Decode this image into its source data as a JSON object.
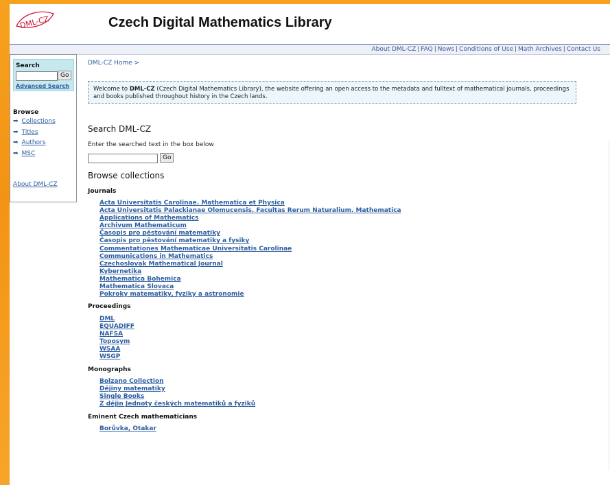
{
  "header": {
    "logo_text": "DML-CZ",
    "title": "Czech Digital Mathematics Library"
  },
  "topbar": {
    "links": [
      "About DML-CZ",
      "FAQ",
      "News",
      "Conditions of Use",
      "Math Archives",
      "Contact Us"
    ]
  },
  "sidebar": {
    "search_label": "Search",
    "search_value": "",
    "go_label": "Go",
    "advanced_search": "Advanced Search",
    "browse_title": "Browse",
    "browse_items": [
      "Collections",
      "Titles",
      "Authors",
      "MSC"
    ],
    "about": "About DML-CZ"
  },
  "main": {
    "breadcrumb": "DML-CZ Home >",
    "welcome_prefix": "Welcome to ",
    "welcome_bold": "DML-CZ",
    "welcome_rest": " (Czech Digital Mathematics Library), the website offering an open access to the metadata and fulltext of mathematical journals, proceedings and books published throughout history in the Czech lands.",
    "search_heading": "Search DML-CZ",
    "search_hint": "Enter the searched text in the box below",
    "search_value": "",
    "go_label": "Go",
    "browse_heading": "Browse collections",
    "categories": {
      "journals": {
        "title": "Journals",
        "items": [
          "Acta Universitatis Carolinae. Mathematica et Physica",
          "Acta Universitatis Palackianae Olomucensis. Facultas Rerum Naturalium. Mathematica",
          "Applications of Mathematics",
          "Archivum Mathematicum",
          "Časopis pro pěstování matematiky",
          "Časopis pro pěstování matematiky a fysiky",
          "Commentationes Mathematicae Universitatis Carolinae",
          "Communications in Mathematics",
          "Czechoslovak Mathematical Journal",
          "Kybernetika",
          "Mathematica Bohemica",
          "Mathematica Slovaca",
          "Pokroky matematiky, fyziky a astronomie"
        ]
      },
      "proceedings": {
        "title": "Proceedings",
        "items": [
          "DML",
          "EQUADIFF",
          "NAFSA",
          "Toposym",
          "WSAA",
          "WSGP"
        ]
      },
      "monographs": {
        "title": "Monographs",
        "items": [
          "Bolzano Collection",
          "Dějiny matematiky",
          "Single Books",
          "Z dějin Jednoty českých matematiků a fyziků"
        ]
      },
      "eminent": {
        "title": "Eminent Czech mathematicians",
        "items": [
          "Borůvka, Otakar"
        ]
      }
    }
  },
  "colors": {
    "background_orange": "#f39314",
    "link_blue": "#2d5ea0",
    "search_box_bg": "#c6e9ef",
    "welcome_bg": "#ecf7fb"
  }
}
